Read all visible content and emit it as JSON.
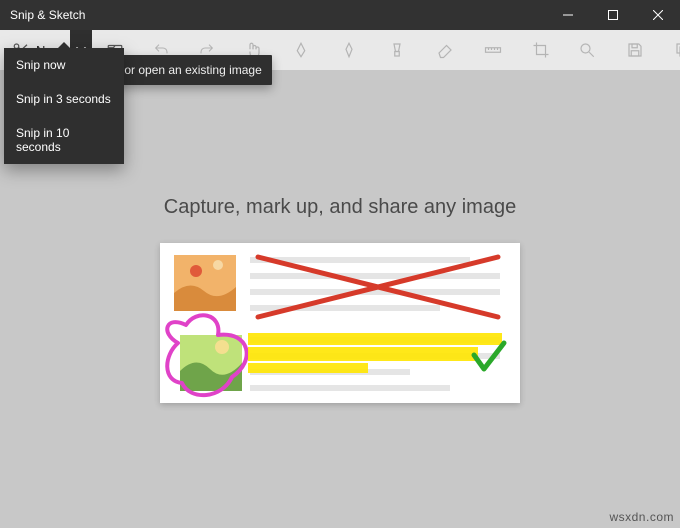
{
  "app": {
    "title": "Snip & Sketch"
  },
  "toolbar": {
    "new_label": "New"
  },
  "dropdown": {
    "items": [
      {
        "label": "Snip now"
      },
      {
        "label": "Snip in 3 seconds"
      },
      {
        "label": "Snip in 10 seconds"
      }
    ]
  },
  "tooltip": {
    "text": "screen or open an existing image"
  },
  "empty_state": {
    "headline": "Capture, mark up, and share any image"
  },
  "colors": {
    "titlebar_bg": "#323232",
    "toolbar_bg": "#e9e9e9",
    "canvas_bg": "#c8c8c8",
    "accent_red": "#d63a2a",
    "accent_yellow": "#ffe600",
    "accent_green": "#2aa82a",
    "accent_magenta": "#e042c8"
  },
  "watermark": {
    "text": "wsxdn.com"
  }
}
